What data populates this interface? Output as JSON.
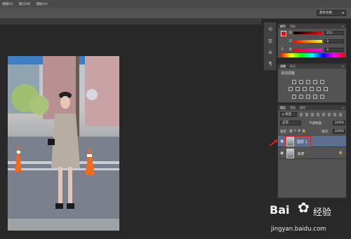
{
  "menubar": {
    "items": [
      "视图(V)",
      "窗口(W)",
      "帮助(H)"
    ]
  },
  "optionsbar": {
    "workspace": "基本功能"
  },
  "color_panel": {
    "tabs": [
      "颜色",
      "色板"
    ],
    "channels": [
      {
        "label": "R",
        "value": "251"
      },
      {
        "label": "G",
        "value": "3"
      },
      {
        "label": "B",
        "value": "3"
      }
    ],
    "foreground_color": "#fb0303",
    "background_color": "#000000"
  },
  "adjust_panel": {
    "tabs": [
      "调整",
      "样式"
    ],
    "title": "添加调整"
  },
  "layers_panel": {
    "tabs": [
      "图层",
      "通道",
      "路径"
    ],
    "kind_filter": "ρ 类型",
    "blend_mode": "正常",
    "opacity_label": "不透明度:",
    "opacity_value": "100%",
    "lock_label": "锁定:",
    "fill_label": "填充:",
    "fill_value": "100%",
    "layers": [
      {
        "name": "图层 1",
        "selected": true,
        "highlighted_red": true
      },
      {
        "name": "背景",
        "locked": true
      }
    ]
  },
  "watermark": {
    "brand": "Bai",
    "brand2": "经验",
    "url": "jingyan.baidu.com"
  }
}
